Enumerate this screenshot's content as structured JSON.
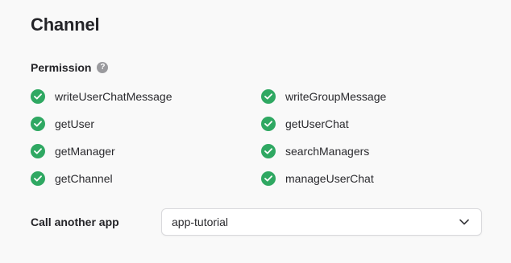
{
  "section": {
    "title": "Channel"
  },
  "permission": {
    "label": "Permission",
    "help_icon": "question-circle-icon",
    "check_color": "#2fa862",
    "items": [
      {
        "label": "writeUserChatMessage",
        "icon": "check-circle-icon"
      },
      {
        "label": "writeGroupMessage",
        "icon": "check-circle-icon"
      },
      {
        "label": "getUser",
        "icon": "check-circle-icon"
      },
      {
        "label": "getUserChat",
        "icon": "check-circle-icon"
      },
      {
        "label": "getManager",
        "icon": "check-circle-icon"
      },
      {
        "label": "searchManagers",
        "icon": "check-circle-icon"
      },
      {
        "label": "getChannel",
        "icon": "check-circle-icon"
      },
      {
        "label": "manageUserChat",
        "icon": "check-circle-icon"
      }
    ]
  },
  "call_another_app": {
    "label": "Call another app",
    "selected_value": "app-tutorial",
    "icon": "chevron-down-icon"
  }
}
